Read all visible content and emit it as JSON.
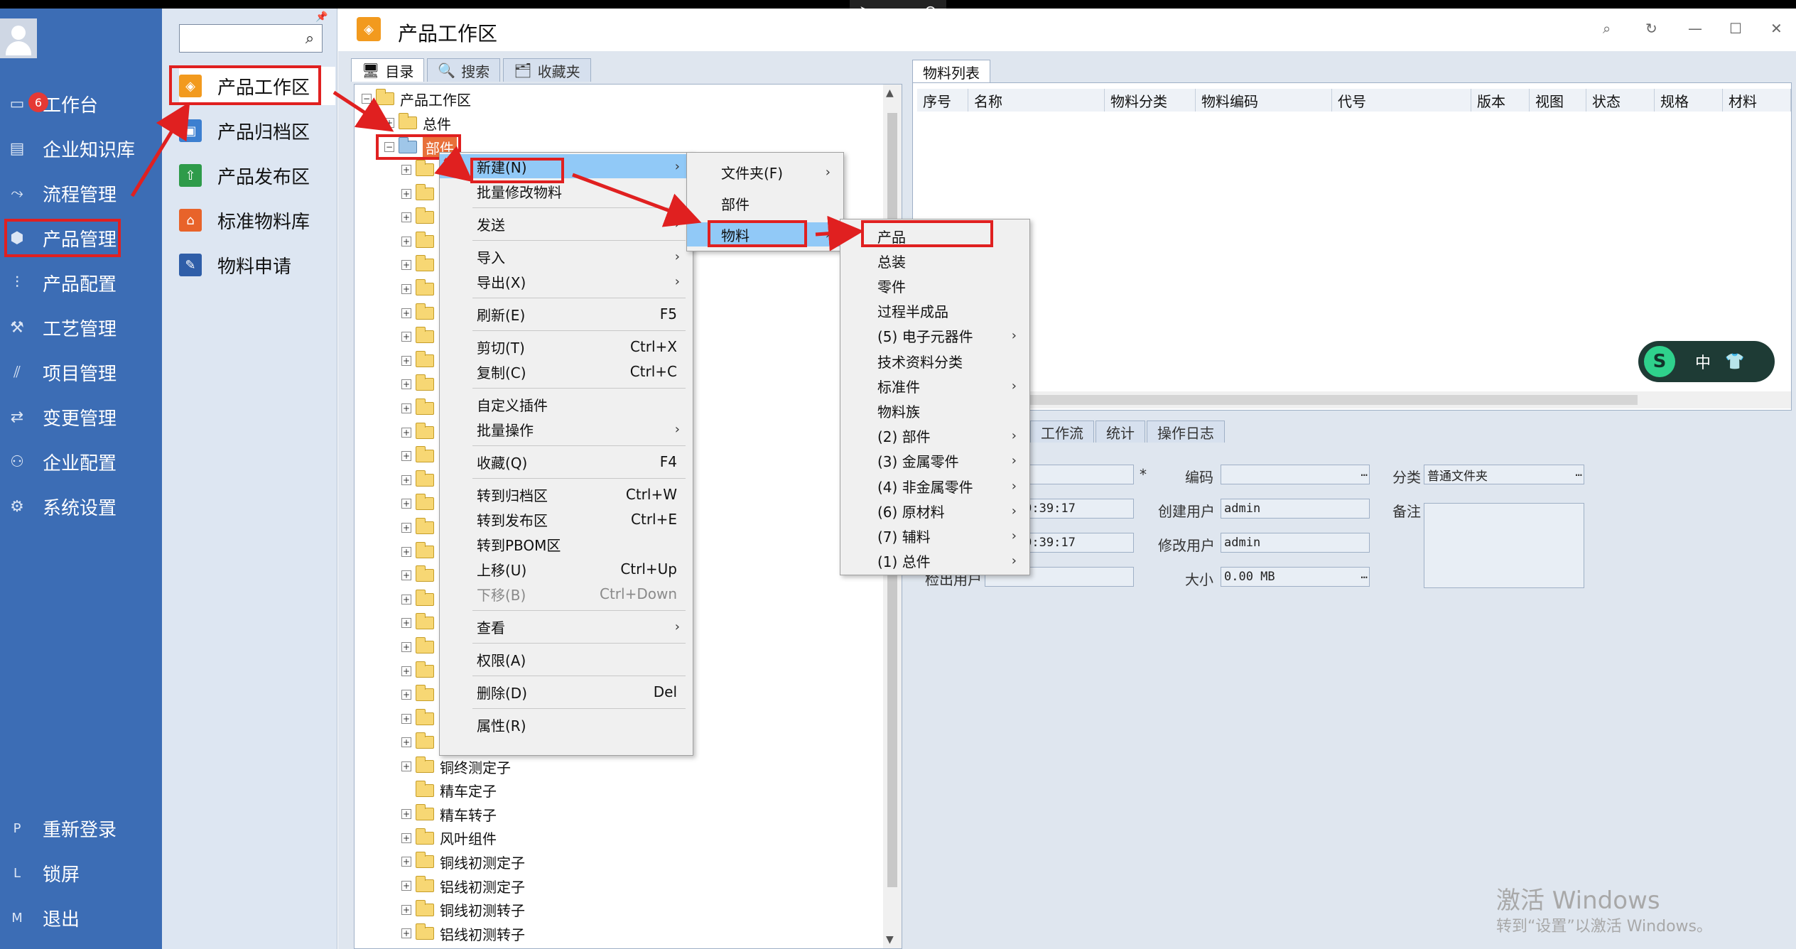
{
  "remote_bar": {
    "icons": [
      "pointer-icon",
      "minimize-window-icon",
      "close-icon"
    ]
  },
  "left_nav": {
    "items": [
      {
        "label": "工作台",
        "icon": "monitor-icon",
        "badge": "6"
      },
      {
        "label": "企业知识库",
        "icon": "book-icon"
      },
      {
        "label": "流程管理",
        "icon": "flow-icon"
      },
      {
        "label": "产品管理",
        "icon": "cube-icon"
      },
      {
        "label": "产品配置",
        "icon": "sliders-icon"
      },
      {
        "label": "工艺管理",
        "icon": "wrench-icon"
      },
      {
        "label": "项目管理",
        "icon": "chart-icon"
      },
      {
        "label": "变更管理",
        "icon": "change-icon"
      },
      {
        "label": "企业配置",
        "icon": "users-icon"
      },
      {
        "label": "系统设置",
        "icon": "gear-icon"
      }
    ],
    "footer": [
      {
        "key": "P",
        "label": "重新登录"
      },
      {
        "key": "L",
        "label": "锁屏"
      },
      {
        "key": "M",
        "label": "退出"
      }
    ]
  },
  "sub_nav": {
    "search_placeholder": "",
    "items": [
      {
        "label": "产品工作区",
        "color": "#f29a1e"
      },
      {
        "label": "产品归档区",
        "color": "#3c7fd0"
      },
      {
        "label": "产品发布区",
        "color": "#2e9b4a"
      },
      {
        "label": "标准物料库",
        "color": "#e8632a"
      },
      {
        "label": "物料申请",
        "color": "#2f5ea8"
      }
    ]
  },
  "title": "产品工作区",
  "left_tabs": [
    "目录",
    "搜索",
    "收藏夹"
  ],
  "tree": {
    "root": "产品工作区",
    "level1": [
      "总件",
      "部件"
    ],
    "children_bottom": [
      "铜终测定子",
      "精车定子",
      "精车转子",
      "风叶组件",
      "铜线初测定子",
      "铝线初测定子",
      "铜线初测转子",
      "铝线初测转子"
    ]
  },
  "right_tab": "物料列表",
  "columns": [
    "序号",
    "名称",
    "物料分类",
    "物料编码",
    "代号",
    "版本",
    "视图",
    "状态",
    "规格",
    "材料"
  ],
  "bottom_tabs": [
    "工作流",
    "统计",
    "操作日志"
  ],
  "form": {
    "required_mark": "*",
    "code_label": "编码",
    "category_label": "分类",
    "category_value": "普通文件夹",
    "date1": "-22 19:39:17",
    "date2": "-22 19:39:17",
    "create_user_label": "创建用户",
    "create_user_value": "admin",
    "modify_user_label": "修改用户",
    "modify_user_value": "admin",
    "checkout_label": "检出用户",
    "size_label": "大小",
    "size_value": "0.00 MB",
    "note_label": "备注"
  },
  "context_menu": [
    {
      "label": "新建(N)",
      "shortcut": "",
      "sub": true
    },
    {
      "label": "批量修改物料",
      "shortcut": "",
      "sub": false
    },
    {
      "label": "发送",
      "shortcut": "",
      "sub": true
    },
    {
      "label": "导入",
      "shortcut": "",
      "sub": true
    },
    {
      "label": "导出(X)",
      "shortcut": "",
      "sub": true
    },
    {
      "label": "刷新(E)",
      "shortcut": "F5",
      "sub": false
    },
    {
      "label": "剪切(T)",
      "shortcut": "Ctrl+X",
      "sub": false
    },
    {
      "label": "复制(C)",
      "shortcut": "Ctrl+C",
      "sub": false
    },
    {
      "label": "自定义插件",
      "shortcut": "",
      "sub": false
    },
    {
      "label": "批量操作",
      "shortcut": "",
      "sub": true
    },
    {
      "label": "收藏(Q)",
      "shortcut": "F4",
      "sub": false
    },
    {
      "label": "转到归档区",
      "shortcut": "Ctrl+W",
      "sub": false
    },
    {
      "label": "转到发布区",
      "shortcut": "Ctrl+E",
      "sub": false
    },
    {
      "label": "转到PBOM区",
      "shortcut": "",
      "sub": false
    },
    {
      "label": "上移(U)",
      "shortcut": "Ctrl+Up",
      "sub": false
    },
    {
      "label": "下移(B)",
      "shortcut": "Ctrl+Down",
      "sub": false
    },
    {
      "label": "查看",
      "shortcut": "",
      "sub": true
    },
    {
      "label": "权限(A)",
      "shortcut": "",
      "sub": false
    },
    {
      "label": "删除(D)",
      "shortcut": "Del",
      "sub": false
    },
    {
      "label": "属性(R)",
      "shortcut": "",
      "sub": false
    }
  ],
  "submenu_new": [
    {
      "label": "文件夹(F)",
      "sub": true
    },
    {
      "label": "部件",
      "sub": false
    },
    {
      "label": "物料",
      "sub": true
    }
  ],
  "submenu_material": [
    {
      "label": "产品",
      "sub": false
    },
    {
      "label": "总装",
      "sub": false
    },
    {
      "label": "零件",
      "sub": false
    },
    {
      "label": "过程半成品",
      "sub": false
    },
    {
      "label": "(5) 电子元器件",
      "sub": true
    },
    {
      "label": "技术资料分类",
      "sub": false
    },
    {
      "label": "标准件",
      "sub": true
    },
    {
      "label": "物料族",
      "sub": false
    },
    {
      "label": "(2) 部件",
      "sub": true
    },
    {
      "label": "(3) 金属零件",
      "sub": true
    },
    {
      "label": "(4) 非金属零件",
      "sub": true
    },
    {
      "label": "(6) 原材料",
      "sub": true
    },
    {
      "label": "(7) 辅料",
      "sub": true
    },
    {
      "label": "(1) 总件",
      "sub": true
    }
  ],
  "ime_pill": {
    "s": "S",
    "lang": "中"
  },
  "watermark": {
    "line1": "激活 Windows",
    "line2": "转到“设置”以激活 Windows。"
  }
}
